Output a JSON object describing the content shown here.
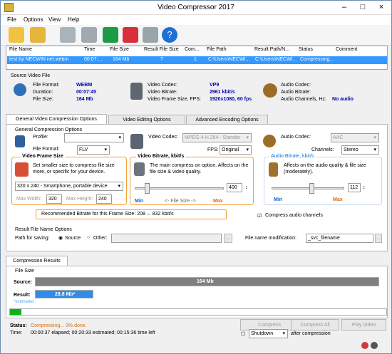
{
  "title": "Video Compressor 2017",
  "menu": [
    "File",
    "Options",
    "View",
    "Help"
  ],
  "file_list": {
    "headers": [
      "File Name",
      "Time",
      "File Size",
      "Result File Size",
      "Com...",
      "File Path",
      "Result Path/N...",
      "Status",
      "Comment"
    ],
    "row": [
      "test by NECWIN net.webm",
      "00:07:...",
      "164 Mb",
      "?",
      "1",
      "C:\\Users\\NECWI...",
      "C:\\Users\\NECWI...",
      "Compressing...",
      ""
    ]
  },
  "source": {
    "heading": "Source Video File",
    "file_format_label": "File Format:",
    "file_format": "WEBM",
    "duration_label": "Duration:",
    "duration": "00:07:45",
    "file_size_label": "File Size:",
    "file_size": "164 Mb",
    "video_codec_label": "Video Codec:",
    "video_codec": "VP9",
    "video_bitrate_label": "Video Bitrate:",
    "video_bitrate": "2961 kbit/s",
    "frame_label": "Video Frame Size, FPS:",
    "frame": "1920x1080, 60 fps",
    "audio_codec_label": "Audio Codec:",
    "audio_codec": "",
    "audio_bitrate_label": "Audio Bitrate:",
    "audio_bitrate": "",
    "audio_channels_label": "Audio Channels, Hz:",
    "audio_channels": "No audio"
  },
  "tabs": [
    "General Video Compression Options",
    "Video Editing Options",
    "Advanced Encoding Options"
  ],
  "general": {
    "heading": "General Compression Options",
    "profile_label": "Profile:",
    "profile": "",
    "file_format_label": "File Format:",
    "file_format": "FLV",
    "video_codec_label": "Video Codec:",
    "video_codec": "MPEG-4 H.264 - Standar",
    "fps_label": "FPS:",
    "fps": "Original",
    "audio_codec_label": "Audio Codec:",
    "audio_codec": "AAC",
    "channels_label": "Channels:",
    "channels": "Stereo",
    "frame_heading": "Video Frame Size",
    "frame_text": "Set smaller size to compress file size more, or specific for your device.",
    "frame_select": "320 x 240 - Smartphone, portable device",
    "max_width_label": "Max Width:",
    "max_width": "320",
    "max_height_label": "Max Height:",
    "max_height": "240",
    "bitrate_heading": "Video Bitrate, kbit/s",
    "bitrate_text": "The main compress on option. Affects on the file size & video quality.",
    "bitrate_value": "400",
    "min": "Min",
    "file_size_slider": "<- File Size ->",
    "max": "Max",
    "audio_heading": "Audio Bitrate, kbit/s",
    "audio_text": "Affects on the audio quality & file size (moderately).",
    "audio_value": "112",
    "audio_min": "Min",
    "audio_max": "Max",
    "recommended": "Recommended Bitrate for this Frame Size: 208 ... 832 kbit/s",
    "compress_audio": "Compress audio channels"
  },
  "result": {
    "heading": "Result File Name Options",
    "path_label": "Path for saving:",
    "source": "Source",
    "other": "Other:",
    "modification_label": "File name modification:",
    "modification": "_svc_filename"
  },
  "results": {
    "tab": "Compression Results",
    "file_size_label": "File Size",
    "source_label": "Source:",
    "source_value": "164 Mb",
    "result_label": "Result:",
    "result_value": "28.8 Mb*",
    "estimated": "*estimated",
    "progress": 0.03,
    "status_label": "Status:",
    "status": "Compressing... 3% done.",
    "time_label": "Time:",
    "time": "00:00:37 elapsed; 00:20:33 estimated; 00:15:36 time left",
    "compress": "Compress",
    "compress_all": "Compress All",
    "play_video": "Play Video",
    "shutdown": "Shutdown",
    "after": "after compression"
  }
}
